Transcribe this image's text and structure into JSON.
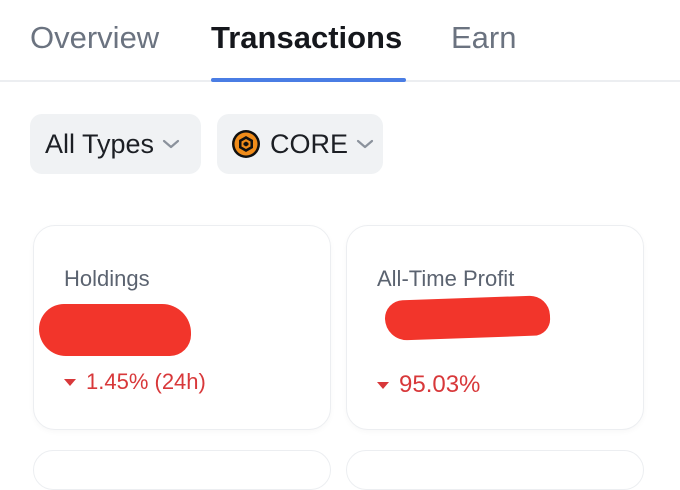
{
  "tabs": {
    "overview": "Overview",
    "transactions": "Transactions",
    "earn": "Earn",
    "active": "Transactions"
  },
  "filters": {
    "type_label": "All Types",
    "coin_label": "CORE"
  },
  "cards": {
    "holdings": {
      "label": "Holdings",
      "change": "1.45% (24h)",
      "direction": "down"
    },
    "profit": {
      "label": "All-Time Profit",
      "change": "95.03%",
      "direction": "down"
    }
  },
  "colors": {
    "accent": "#4a7de4",
    "negative": "#d8383a",
    "redaction": "#f2352b",
    "coin": "#f08c1a"
  },
  "icons": {
    "chevron": "chevron-down-icon",
    "coin": "core-coin-icon",
    "change": "caret-down-icon"
  }
}
